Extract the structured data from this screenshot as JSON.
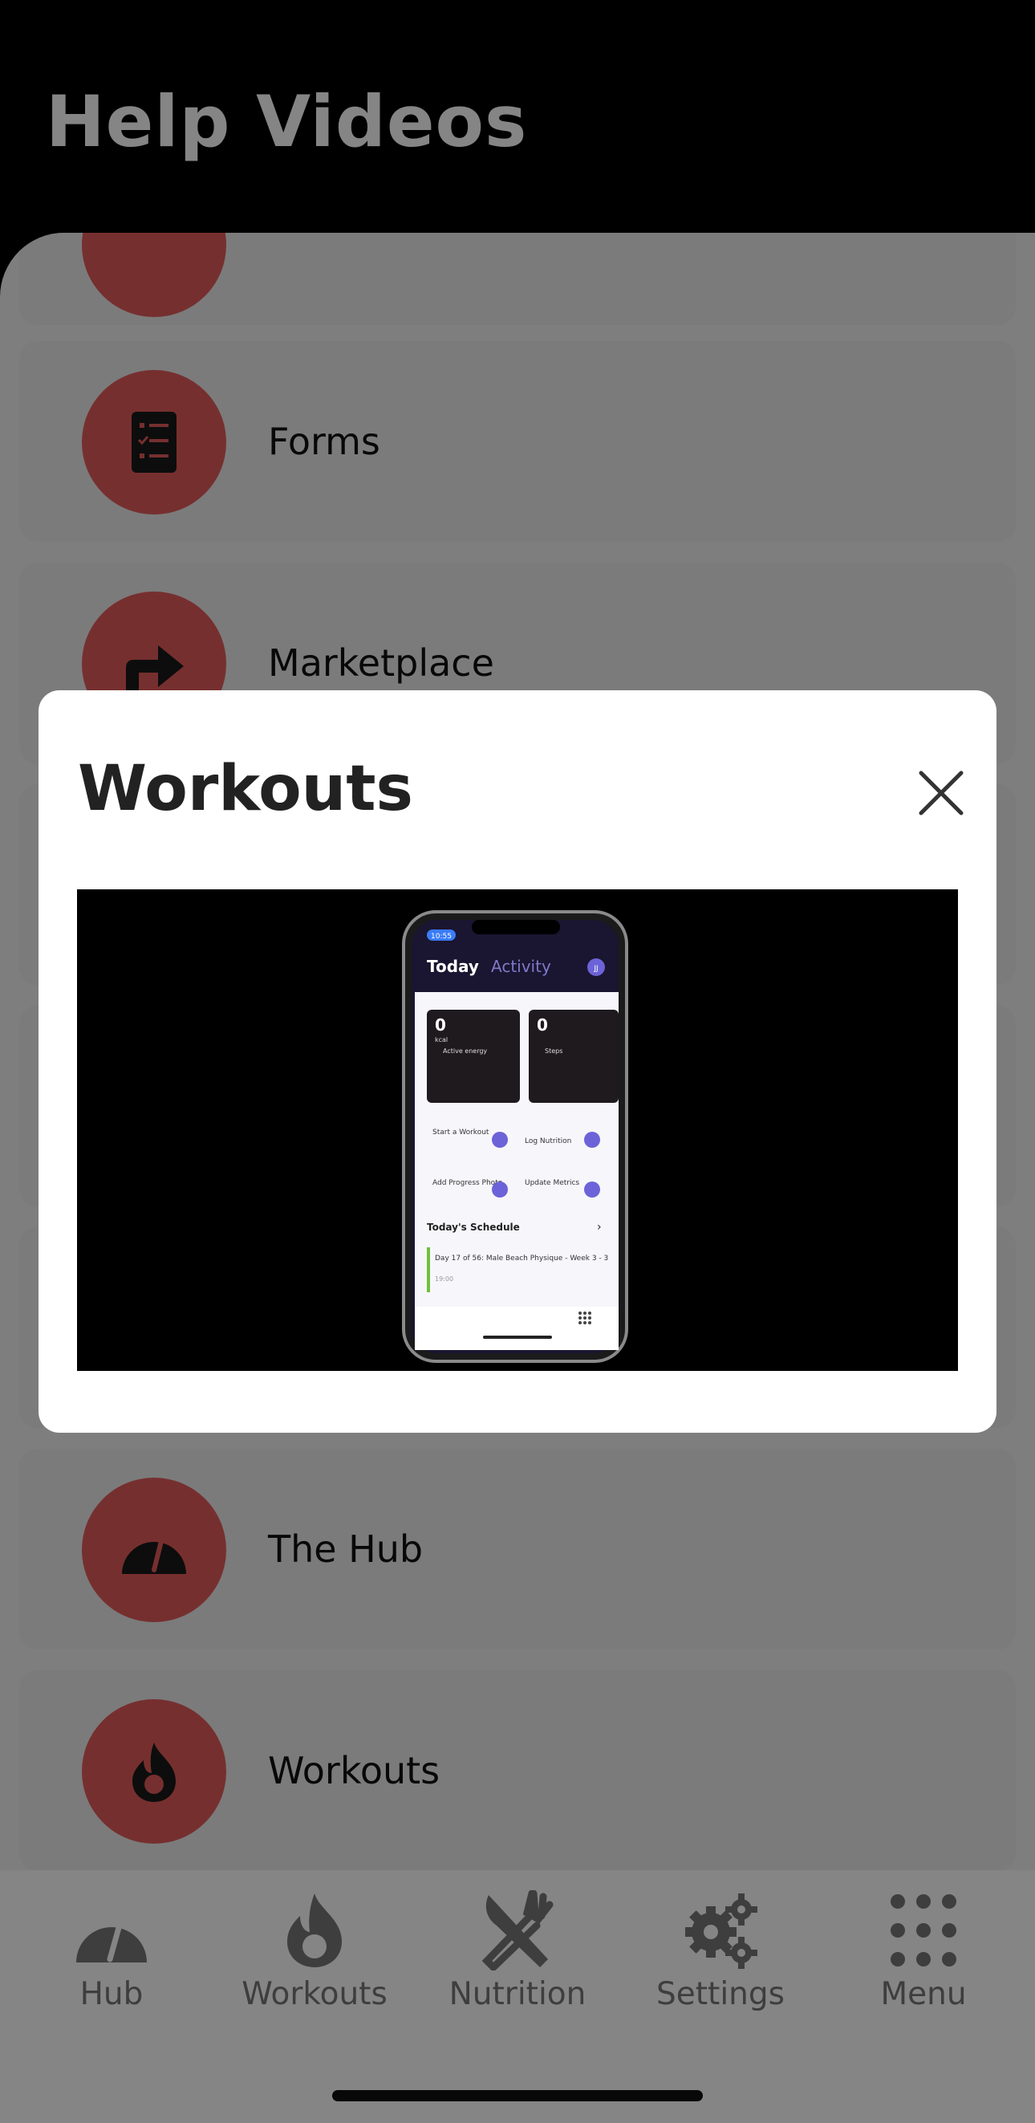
{
  "header": {
    "title": "Help Videos"
  },
  "list": {
    "items": [
      {
        "label": "",
        "icon": "partial-icon"
      },
      {
        "label": "Forms",
        "icon": "form-list-icon"
      },
      {
        "label": "Marketplace",
        "icon": "marketplace-arrow-icon"
      },
      {
        "label": "The Hub",
        "icon": "speedometer-icon"
      },
      {
        "label": "Workouts",
        "icon": "flame-icon"
      }
    ]
  },
  "modal": {
    "title": "Workouts",
    "close_icon": "close-icon",
    "video": {
      "phone": {
        "time": "10:55",
        "tab_today": "Today",
        "tab_activity": "Activity",
        "avatar": "JJ",
        "card1_value": "0",
        "card1_unit": "kcal",
        "card1_label": "Active energy",
        "card2_value": "0",
        "card2_label": "Steps",
        "action1": "Start a Workout",
        "action2": "Log Nutrition",
        "action3": "Add Progress Photo",
        "action4": "Update Metrics",
        "schedule_title": "Today's Schedule",
        "schedule_item": "Day 17 of 56: Male Beach Physique - Week 3 - 3",
        "schedule_time": "19:00"
      }
    }
  },
  "tabbar": {
    "tabs": [
      {
        "label": "Hub",
        "icon": "speedometer-icon"
      },
      {
        "label": "Workouts",
        "icon": "flame-icon"
      },
      {
        "label": "Nutrition",
        "icon": "fork-knife-icon"
      },
      {
        "label": "Settings",
        "icon": "gear-icon"
      },
      {
        "label": "Menu",
        "icon": "grid-dots-icon"
      }
    ]
  },
  "colors": {
    "accent": "#e25a5a",
    "header_bg": "#000000",
    "tab_inactive": "#777777"
  }
}
